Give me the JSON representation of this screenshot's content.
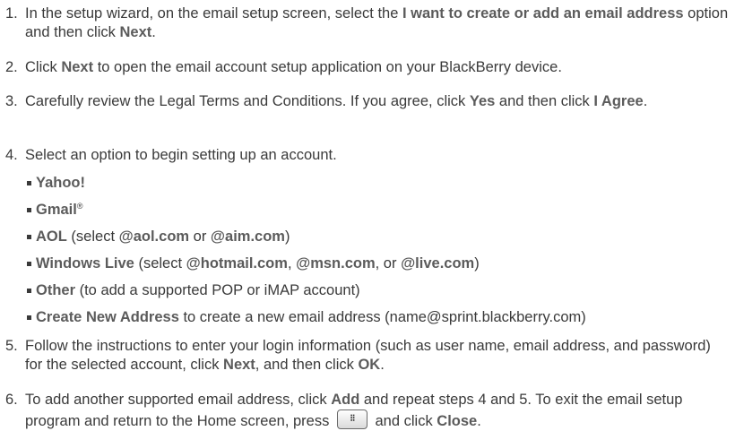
{
  "steps": [
    {
      "num": "1.",
      "parts": [
        "In the setup wizard, on the email setup screen, select the ",
        "I want to create or add an email address",
        " option and then click ",
        "Next",
        "."
      ]
    },
    {
      "num": "2.",
      "parts": [
        "Click ",
        "Next",
        " to open the email account setup application on your BlackBerry device."
      ]
    },
    {
      "num": "3.",
      "parts": [
        "Carefully review the Legal Terms and Conditions. If you agree, click ",
        "Yes",
        " and then click ",
        "I Agree",
        "."
      ]
    },
    {
      "num": "4.",
      "parts": [
        "Select an option to begin setting up an account."
      ]
    },
    {
      "num": "5.",
      "parts": [
        "Follow the instructions to enter your login information (such as user name, email address, and password) for the selected account, click ",
        "Next",
        ", and then click ",
        "OK",
        "."
      ]
    },
    {
      "num": "6.",
      "parts": [
        "To add another supported email address, click ",
        "Add",
        " and repeat steps 4 and 5. To exit the email setup program and return to the Home screen, press ",
        " and click ",
        "Close",
        "."
      ]
    }
  ],
  "options": {
    "yahoo": "Yahoo!",
    "gmail": "Gmail",
    "gmail_mark": "®",
    "aol": [
      "AOL",
      " (select ",
      "@aol.com",
      " or ",
      "@aim.com",
      ")"
    ],
    "windows_live": [
      "Windows Live",
      " (select ",
      "@hotmail.com",
      ", ",
      "@msn.com",
      ", or ",
      "@live.com",
      ")"
    ],
    "other": [
      "Other",
      " (to add a supported POP or iMAP account)"
    ],
    "create_new": [
      "Create New Address",
      " to create a new email address (name@sprint.blackberry.com)"
    ]
  },
  "menu_key": {
    "icon": "blackberry-menu-key-icon",
    "glyph": "⁝⁝"
  }
}
